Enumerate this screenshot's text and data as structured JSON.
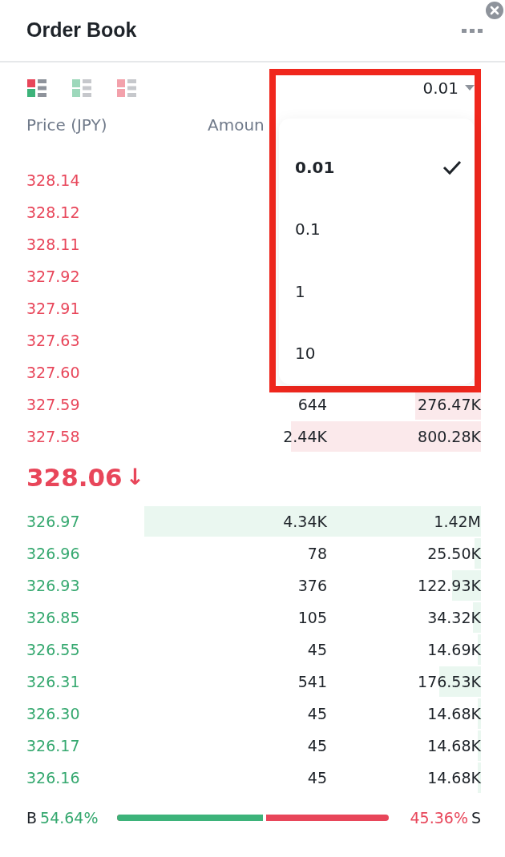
{
  "panel": {
    "title": "Order Book"
  },
  "layouts": [
    {
      "kind": "both",
      "selected": true
    },
    {
      "kind": "bids",
      "selected": false
    },
    {
      "kind": "asks",
      "selected": false
    }
  ],
  "precision": {
    "value": "0.01",
    "options": [
      {
        "label": "0.01",
        "selected": true
      },
      {
        "label": "0.1",
        "selected": false
      },
      {
        "label": "1",
        "selected": false
      },
      {
        "label": "10",
        "selected": false
      }
    ]
  },
  "columns": [
    "Price (JPY)",
    "Amoun"
  ],
  "asks": [
    {
      "price": "328.14"
    },
    {
      "price": "328.12"
    },
    {
      "price": "328.11"
    },
    {
      "price": "327.92"
    },
    {
      "price": "327.91"
    },
    {
      "price": "327.63"
    },
    {
      "price": "327.60"
    },
    {
      "price": "327.59",
      "amount": "644",
      "total": "276.47K"
    },
    {
      "price": "327.58",
      "amount": "2.44K",
      "total": "800.28K"
    }
  ],
  "last_price": {
    "value": "328.06",
    "arrow": "↓"
  },
  "bids": [
    {
      "price": "326.97",
      "amount": "4.34K",
      "total": "1.42M"
    },
    {
      "price": "326.96",
      "amount": "78",
      "total": "25.50K"
    },
    {
      "price": "326.93",
      "amount": "376",
      "total": "122.93K"
    },
    {
      "price": "326.85",
      "amount": "105",
      "total": "34.32K"
    },
    {
      "price": "326.55",
      "amount": "45",
      "total": "14.69K"
    },
    {
      "price": "326.31",
      "amount": "541",
      "total": "176.53K"
    },
    {
      "price": "326.30",
      "amount": "45",
      "total": "14.68K"
    },
    {
      "price": "326.17",
      "amount": "45",
      "total": "14.68K"
    },
    {
      "price": "326.16",
      "amount": "45",
      "total": "14.68K"
    }
  ],
  "ratio": {
    "buy_label": "B",
    "buy": "54.64%",
    "sell": "45.36%",
    "sell_label": "S",
    "level": 0.5464
  }
}
